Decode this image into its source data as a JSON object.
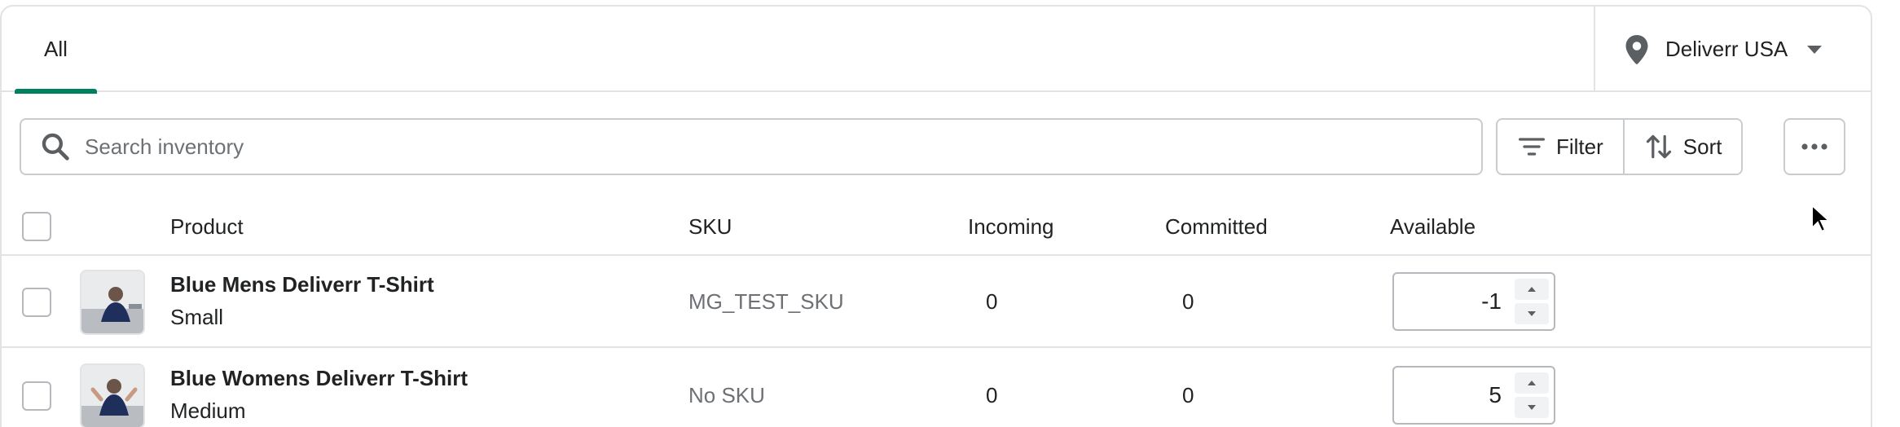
{
  "tabs": [
    {
      "label": "All",
      "active": true
    }
  ],
  "location": {
    "label": "Deliverr USA",
    "icon": "location-pin-icon"
  },
  "search": {
    "placeholder": "Search inventory",
    "value": ""
  },
  "toolbar": {
    "filter_label": "Filter",
    "sort_label": "Sort",
    "more_icon": "more-horizontal-icon"
  },
  "table": {
    "columns": [
      "Product",
      "SKU",
      "Incoming",
      "Committed",
      "Available"
    ],
    "rows": [
      {
        "name": "Blue Mens Deliverr T-Shirt",
        "variant": "Small",
        "sku": "MG_TEST_SKU",
        "incoming": "0",
        "committed": "0",
        "available": "-1"
      },
      {
        "name": "Blue Womens Deliverr T-Shirt",
        "variant": "Medium",
        "sku": "No SKU",
        "incoming": "0",
        "committed": "0",
        "available": "5"
      }
    ]
  },
  "colors": {
    "accent": "#008060",
    "border": "#e1e3e5",
    "muted_text": "#6d7175"
  }
}
